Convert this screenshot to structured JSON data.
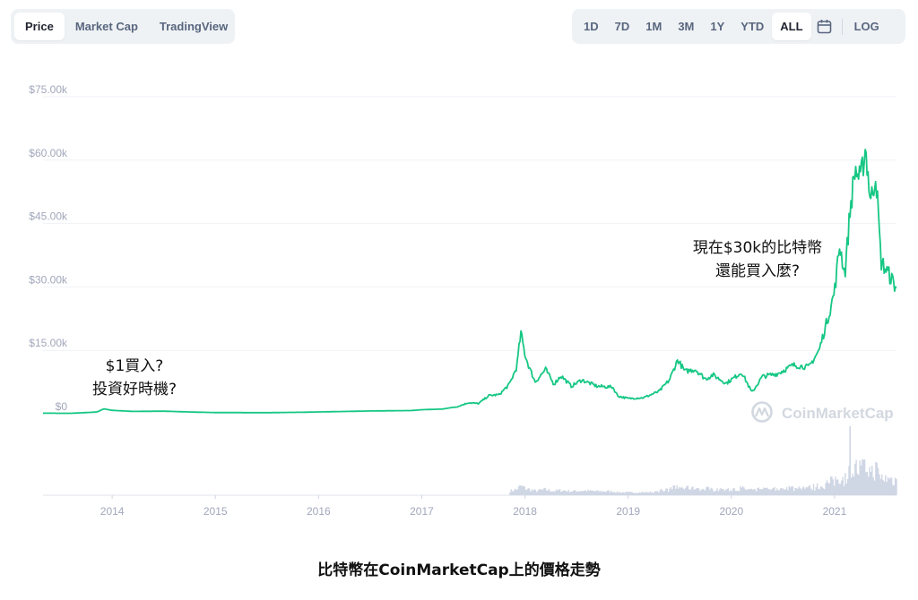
{
  "tabs_left": [
    "Price",
    "Market Cap",
    "TradingView"
  ],
  "tabs_left_active": 0,
  "ranges": [
    "1D",
    "7D",
    "1M",
    "3M",
    "1Y",
    "YTD",
    "ALL"
  ],
  "range_active": 6,
  "log_label": "LOG",
  "watermark": "CoinMarketCap",
  "annotations": {
    "left": [
      "$1買入?",
      "投資好時機?"
    ],
    "right": [
      "現在$30k的比特幣",
      "還能買入麼?"
    ]
  },
  "caption": "比特幣在CoinMarketCap上的價格走勢",
  "colors": {
    "line": "#16c784",
    "volume": "#cfd6e4",
    "grid": "#eff2f5",
    "axis_text": "#a1a7bb",
    "tab_bg": "#eff2f5"
  },
  "chart_data": {
    "type": "line",
    "series": [
      {
        "values": [
          [
            2013.33,
            130
          ],
          [
            2013.6,
            100
          ],
          [
            2013.85,
            400
          ],
          [
            2013.92,
            1150
          ],
          [
            2014.0,
            800
          ],
          [
            2014.2,
            550
          ],
          [
            2014.5,
            600
          ],
          [
            2014.8,
            380
          ],
          [
            2015.0,
            280
          ],
          [
            2015.5,
            250
          ],
          [
            2015.85,
            350
          ],
          [
            2016.0,
            420
          ],
          [
            2016.5,
            650
          ],
          [
            2016.9,
            750
          ],
          [
            2017.0,
            950
          ],
          [
            2017.2,
            1100
          ],
          [
            2017.35,
            1700
          ],
          [
            2017.45,
            2600
          ],
          [
            2017.55,
            2400
          ],
          [
            2017.65,
            4300
          ],
          [
            2017.75,
            4500
          ],
          [
            2017.85,
            7000
          ],
          [
            2017.92,
            11000
          ],
          [
            2017.96,
            19200
          ],
          [
            2018.0,
            14000
          ],
          [
            2018.04,
            11000
          ],
          [
            2018.1,
            7500
          ],
          [
            2018.2,
            10500
          ],
          [
            2018.28,
            7000
          ],
          [
            2018.35,
            9000
          ],
          [
            2018.45,
            6500
          ],
          [
            2018.55,
            8000
          ],
          [
            2018.7,
            6500
          ],
          [
            2018.85,
            6300
          ],
          [
            2018.9,
            4200
          ],
          [
            2019.0,
            3600
          ],
          [
            2019.15,
            3800
          ],
          [
            2019.3,
            5300
          ],
          [
            2019.4,
            8000
          ],
          [
            2019.48,
            12800
          ],
          [
            2019.55,
            10000
          ],
          [
            2019.65,
            10500
          ],
          [
            2019.75,
            8200
          ],
          [
            2019.82,
            9200
          ],
          [
            2019.95,
            7200
          ],
          [
            2020.1,
            9800
          ],
          [
            2020.2,
            5000
          ],
          [
            2020.3,
            8800
          ],
          [
            2020.45,
            9500
          ],
          [
            2020.6,
            11500
          ],
          [
            2020.75,
            11000
          ],
          [
            2020.85,
            15000
          ],
          [
            2020.95,
            24000
          ],
          [
            2021.0,
            29000
          ],
          [
            2021.05,
            40000
          ],
          [
            2021.1,
            33000
          ],
          [
            2021.15,
            48000
          ],
          [
            2021.2,
            58000
          ],
          [
            2021.25,
            55000
          ],
          [
            2021.3,
            63000
          ],
          [
            2021.35,
            50000
          ],
          [
            2021.4,
            57000
          ],
          [
            2021.45,
            36000
          ],
          [
            2021.5,
            34000
          ],
          [
            2021.55,
            32000
          ],
          [
            2021.59,
            30000
          ]
        ]
      }
    ],
    "volume_peak_x": 2021.15,
    "x_ticks": [
      "2014",
      "2015",
      "2016",
      "2017",
      "2018",
      "2019",
      "2020",
      "2021"
    ],
    "x_tick_values": [
      2014,
      2015,
      2016,
      2017,
      2018,
      2019,
      2020,
      2021
    ],
    "y_ticks": [
      "$0",
      "$15.00k",
      "$30.00k",
      "$45.00k",
      "$60.00k",
      "$75.00k"
    ],
    "y_tick_values": [
      0,
      15000,
      30000,
      45000,
      60000,
      75000
    ],
    "xlim": [
      2013.33,
      2021.6
    ],
    "ylim": [
      0,
      75000
    ],
    "grid": true
  }
}
